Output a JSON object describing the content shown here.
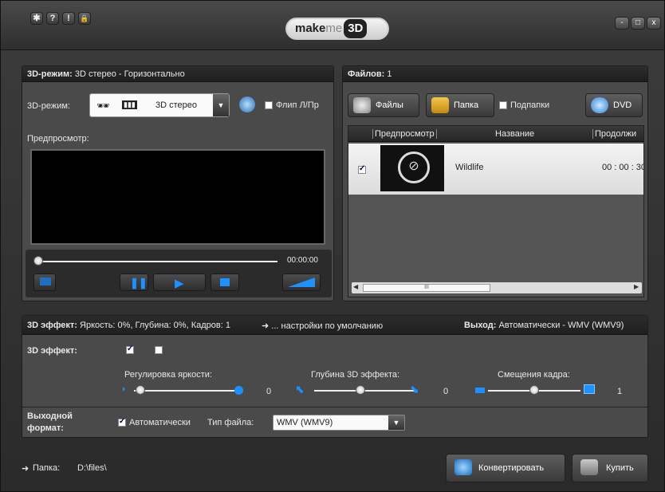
{
  "title_buttons": [
    {
      "icon": "gear-icon",
      "glyph": "✱"
    },
    {
      "icon": "help-icon",
      "glyph": "?"
    },
    {
      "icon": "info-icon",
      "glyph": "!"
    },
    {
      "icon": "lock-icon",
      "glyph": "🔒"
    }
  ],
  "window": {
    "minimize": "-",
    "maximize": "□",
    "close": "x"
  },
  "logo": {
    "make": "make",
    "me": "me",
    "d3": "3D"
  },
  "mode_panel": {
    "header_label": "3D-режим:",
    "header_value": "3D стерео - Горизонтально",
    "mode_label": "3D-режим:",
    "mode_value": "3D стерео",
    "flip_label": "Флип Л/Пр",
    "preview_label": "Предпросмотр:",
    "time": "00:00:00"
  },
  "files_panel": {
    "header_label": "Файлов:",
    "count": "1",
    "files_button": "Файлы",
    "folder_button": "Папка",
    "subfolders_label": "Подпапки",
    "dvd_button": "DVD",
    "columns": [
      "Предпросмотр",
      "Название",
      "Продолжи"
    ],
    "rows": [
      {
        "name": "Wildlife",
        "duration": "00 : 00 : 30"
      }
    ],
    "scroll_thumb": "III"
  },
  "effect_panel": {
    "header_label": "3D эффект:",
    "header_value": "Яркость: 0%, Глубина: 0%, Кадров: 1",
    "defaults_link": "... настройки по умолчанию",
    "output_label": "Выход:",
    "output_value": "Автоматически - WMV (WMV9)",
    "effect_label": "3D эффект:",
    "brightness_label": "Регулировка яркости:",
    "brightness_value": "0",
    "depth_label": "Глубина 3D эффекта:",
    "depth_value": "0",
    "shift_label": "Смещения кадра:",
    "shift_value": "1",
    "format_label_1": "Выходной",
    "format_label_2": "формат:",
    "auto_label": "Автоматически",
    "filetype_label": "Тип файла:",
    "filetype_value": "WMV (WMV9)"
  },
  "bottom": {
    "folder_label": "Папка:",
    "folder_path": "D:\\files\\",
    "convert_button": "Конвертировать",
    "buy_button": "Купить"
  },
  "colors": {
    "accent": "#1e90ff",
    "panel": "#4a4a4a",
    "header": "#222222"
  }
}
